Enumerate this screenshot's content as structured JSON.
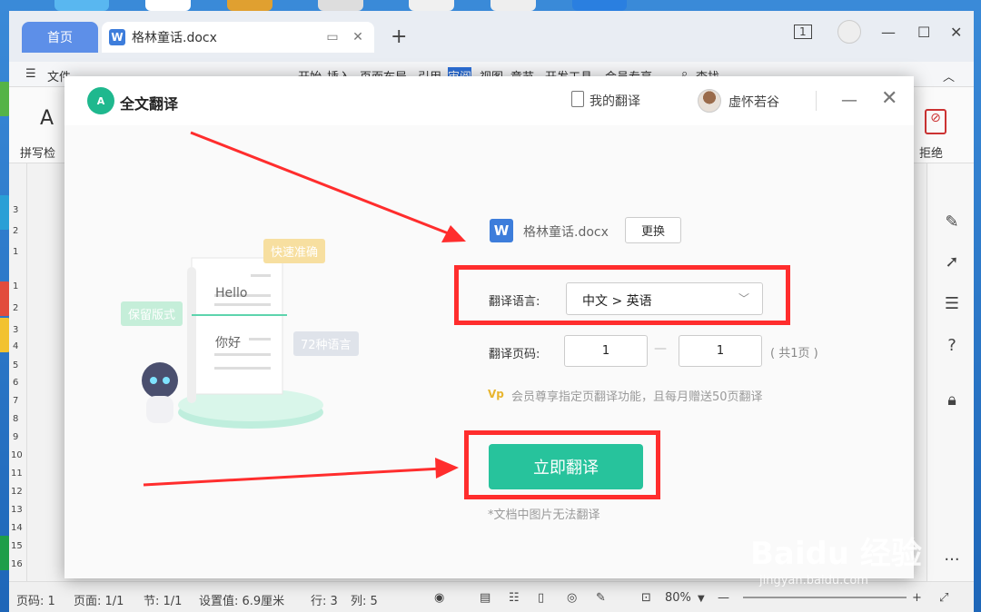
{
  "window": {
    "home_tab": "首页",
    "doc_tab": "格林童话.docx",
    "doc_tab_icon": "W",
    "page_count_badge": "1"
  },
  "ribbon": {
    "menu_file": "文件",
    "tabs": [
      "开始",
      "插入",
      "页面布局",
      "引用",
      "审阅",
      "视图",
      "章节",
      "开发工具",
      "会员专享"
    ],
    "search": "查找"
  },
  "toolrow": {
    "spellcheck": "拼写检",
    "reject": "拒绝"
  },
  "ruler_numbers": [
    "3",
    "2",
    "1",
    "1",
    "2",
    "3",
    "4",
    "5",
    "6",
    "7",
    "8",
    "9",
    "10",
    "11",
    "12",
    "13",
    "14",
    "15",
    "16"
  ],
  "status": {
    "page": "页码: 1",
    "pages": "页面: 1/1",
    "section": "节: 1/1",
    "setting": "设置值: 6.9厘米",
    "row": "行: 3",
    "col": "列: 5",
    "zoom": "80%"
  },
  "dialog": {
    "logo_text": "A",
    "title": "全文翻译",
    "my_translations": "我的翻译",
    "username": "虚怀若谷",
    "illustration": {
      "badge_fast": "快速准确",
      "badge_format": "保留版式",
      "badge_langs": "72种语言",
      "hello": "Hello",
      "nihao": "你好"
    },
    "file_name": "格林童话.docx",
    "file_icon": "W",
    "change_button": "更换",
    "lang_label": "翻译语言:",
    "lang_value": "中文 > 英语",
    "pages_label": "翻译页码:",
    "page_from": "1",
    "page_to": "1",
    "page_dash": "—",
    "page_total": "( 共1页 )",
    "vip_icon": "Vp",
    "member_note": "会员尊享指定页翻译功能，且每月赠送50页翻译",
    "translate_button": "立即翻译",
    "image_note": "*文档中图片无法翻译"
  },
  "watermark": {
    "brand": "Baidu 经验",
    "url": "jingyan.baidu.com"
  },
  "colors": {
    "accent_green": "#27c39c",
    "highlight_red": "#ff2d2d",
    "wps_blue": "#3d7ddb"
  }
}
